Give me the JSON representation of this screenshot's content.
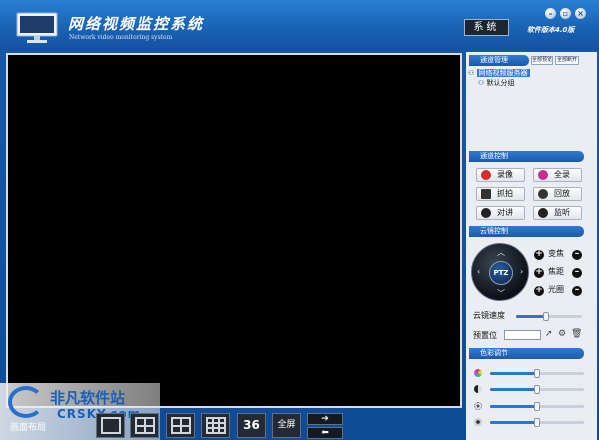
{
  "app": {
    "title": "网络视频监控系统",
    "subtitle": "Network video monitoring system",
    "system_button": "系统",
    "version": "软件版本4.0版"
  },
  "window_controls": {
    "minimize": "–",
    "restore": "▫",
    "close": "×"
  },
  "channel_mgmt": {
    "header": "通道管理",
    "btn_preview_all": "全部预览",
    "btn_disconnect_all": "全部断开",
    "tree_root": "网络视频服务器",
    "tree_child": "默认分组"
  },
  "channel_control": {
    "header": "通道控制",
    "buttons": [
      {
        "label": "录像",
        "icon": "record-icon"
      },
      {
        "label": "全录",
        "icon": "record-all-icon"
      },
      {
        "label": "抓拍",
        "icon": "camera-icon"
      },
      {
        "label": "回放",
        "icon": "playback-icon"
      },
      {
        "label": "对讲",
        "icon": "talk-icon"
      },
      {
        "label": "监听",
        "icon": "headphones-icon"
      }
    ]
  },
  "ptz_control": {
    "header": "云镜控制",
    "center_label": "PTZ",
    "zoom": "变焦",
    "focus": "焦距",
    "iris": "光圈",
    "speed_label": "云镜速度",
    "speed_level": 0.45,
    "preset_label": "预置位",
    "preset_value": ""
  },
  "color_adjust": {
    "header": "色彩调节",
    "sliders": [
      {
        "icon": "hue-icon",
        "level": 0.5
      },
      {
        "icon": "contrast-icon",
        "level": 0.5
      },
      {
        "icon": "brightness-icon",
        "level": 0.5
      },
      {
        "icon": "saturation-icon",
        "level": 0.5
      }
    ]
  },
  "bottom_bar": {
    "layout_label": "画面布局",
    "layout_36": "36",
    "fullscreen": "全屏",
    "next": "➔",
    "prev": "⬅"
  },
  "watermark": {
    "main": "非凡软件站",
    "sub": "CRSKY.com"
  }
}
